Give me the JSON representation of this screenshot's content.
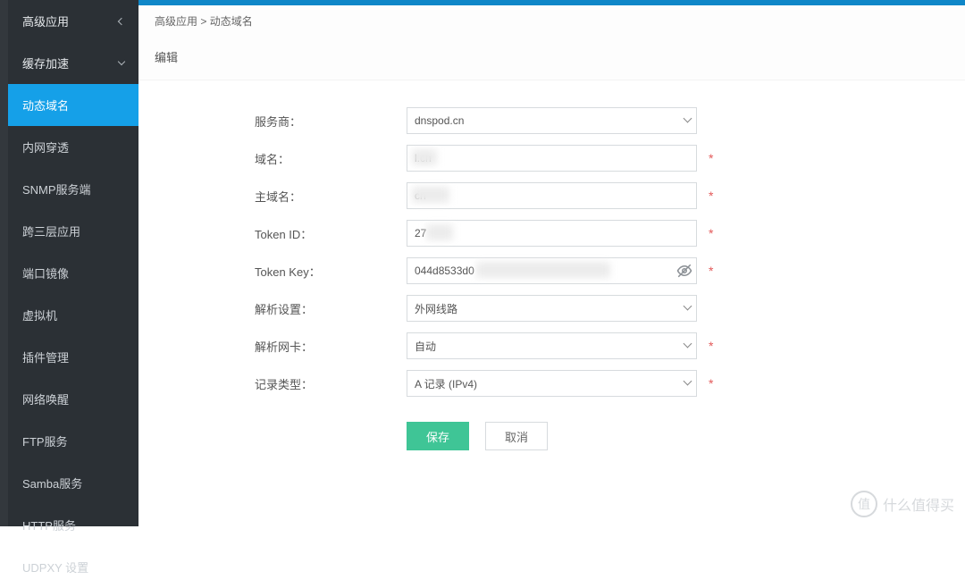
{
  "sidebar": {
    "header": "高级应用",
    "expander": "缓存加速",
    "items": [
      {
        "label": "动态域名",
        "active": true
      },
      {
        "label": "内网穿透"
      },
      {
        "label": "SNMP服务端"
      },
      {
        "label": "跨三层应用"
      },
      {
        "label": "端口镜像"
      },
      {
        "label": "虚拟机"
      },
      {
        "label": "插件管理"
      },
      {
        "label": "网络唤醒"
      },
      {
        "label": "FTP服务"
      },
      {
        "label": "Samba服务"
      },
      {
        "label": "HTTP服务"
      },
      {
        "label": "UDPXY 设置"
      }
    ]
  },
  "breadcrumb": {
    "a": "高级应用",
    "sep": ">",
    "b": "动态域名"
  },
  "section_title": "编辑",
  "form": {
    "provider": {
      "label": "服务商：",
      "value": "dnspod.cn"
    },
    "domain": {
      "label": "域名：",
      "value": "l.cn"
    },
    "hostname": {
      "label": "主域名：",
      "value": "cn"
    },
    "token_id": {
      "label": "Token ID：",
      "value": "27"
    },
    "token_key": {
      "label": "Token Key：",
      "value": "044d8533d0"
    },
    "resolve": {
      "label": "解析设置：",
      "value": "外网线路"
    },
    "nic": {
      "label": "解析网卡：",
      "value": "自动"
    },
    "rectype": {
      "label": "记录类型：",
      "value": "A 记录 (IPv4)"
    }
  },
  "buttons": {
    "save": "保存",
    "cancel": "取消"
  },
  "watermark": {
    "badge": "值",
    "text": "什么值得买"
  }
}
